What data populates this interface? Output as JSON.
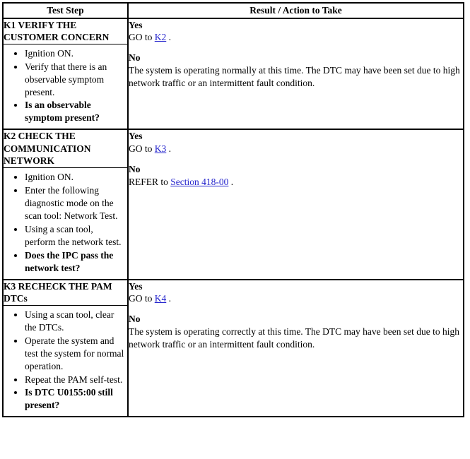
{
  "table": {
    "headers": {
      "step": "Test Step",
      "result": "Result / Action to Take"
    },
    "rows": [
      {
        "id": "K1",
        "title": "K1 VERIFY THE CUSTOMER CONCERN",
        "steps": [
          {
            "text": "Ignition ON.",
            "bold": false
          },
          {
            "text": "Verify that there is an observable symptom present.",
            "bold": false
          },
          {
            "text": "Is an observable symptom present?",
            "bold": true
          }
        ],
        "result": {
          "yes_label": "Yes",
          "yes_prefix": "GO to ",
          "yes_link": "K2",
          "yes_suffix": " .",
          "no_label": "No",
          "no_prefix": "The system is operating normally at this time. The DTC may have been set due to high network traffic or an intermittent fault condition.",
          "no_link": "",
          "no_suffix": ""
        }
      },
      {
        "id": "K2",
        "title": "K2 CHECK THE COMMUNICATION NETWORK",
        "steps": [
          {
            "text": "Ignition ON.",
            "bold": false
          },
          {
            "text": "Enter the following diagnostic mode on the scan tool: Network Test.",
            "bold": false
          },
          {
            "text": "Using a scan tool, perform the network test.",
            "bold": false
          },
          {
            "text": "Does the IPC pass the network test?",
            "bold": true
          }
        ],
        "result": {
          "yes_label": "Yes",
          "yes_prefix": "GO to ",
          "yes_link": "K3",
          "yes_suffix": " .",
          "no_label": "No",
          "no_prefix": "REFER to ",
          "no_link": "Section 418-00",
          "no_suffix": " ."
        }
      },
      {
        "id": "K3",
        "title": "K3 RECHECK THE PAM DTCs",
        "steps": [
          {
            "text": "Using a scan tool, clear the DTCs.",
            "bold": false
          },
          {
            "text": "Operate the system and test the system for normal operation.",
            "bold": false
          },
          {
            "text": "Repeat the PAM self-test.",
            "bold": false
          },
          {
            "text": "Is DTC U0155:00 still present?",
            "bold": true
          }
        ],
        "result": {
          "yes_label": "Yes",
          "yes_prefix": "GO to ",
          "yes_link": "K4",
          "yes_suffix": " .",
          "no_label": "No",
          "no_prefix": "The system is operating correctly at this time. The DTC may have been set due to high network traffic or an intermittent fault condition.",
          "no_link": "",
          "no_suffix": ""
        }
      }
    ]
  },
  "colors": {
    "link": "#2222cc",
    "border": "#000000",
    "text": "#000000",
    "background": "#ffffff"
  }
}
